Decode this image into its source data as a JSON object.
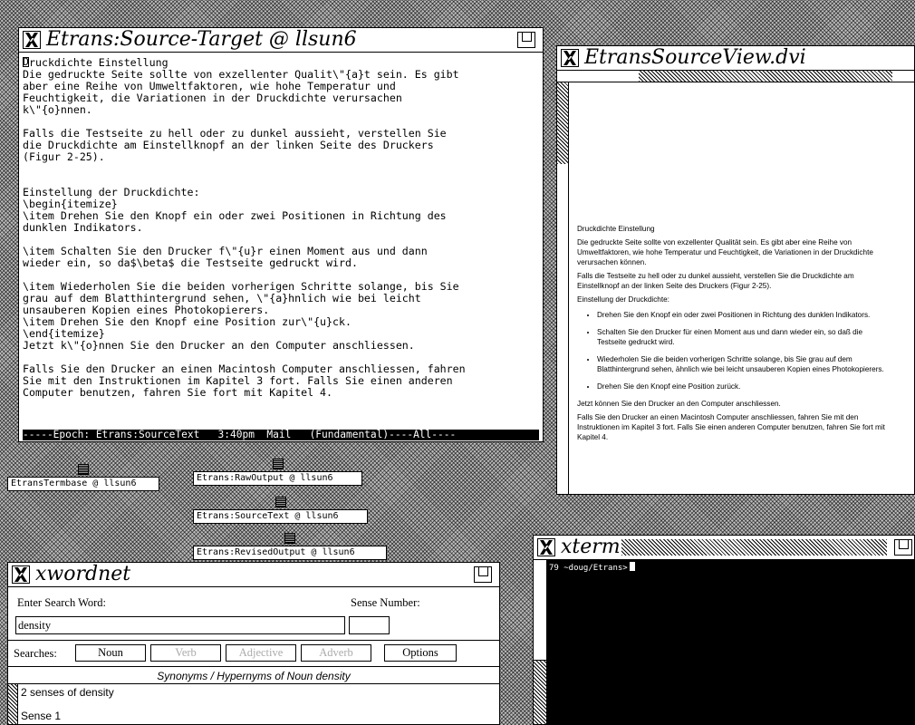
{
  "emacs": {
    "title": "Etrans:Source-Target @ llsun6",
    "first_char": "D",
    "first_line_rest": "ruckdichte Einstellung",
    "body": "\nDie gedruckte Seite sollte von exzellenter Qualit\\\"{a}t sein. Es gibt\naber eine Reihe von Umweltfaktoren, wie hohe Temperatur und\nFeuchtigkeit, die Variationen in der Druckdichte verursachen\nk\\\"{o}nnen.\n\nFalls die Testseite zu hell oder zu dunkel aussieht, verstellen Sie\ndie Druckdichte am Einstellknopf an der linken Seite des Druckers\n(Figur 2-25).\n\n\nEinstellung der Druckdichte:\n\\begin{itemize}\n\\item Drehen Sie den Knopf ein oder zwei Positionen in Richtung des\ndunklen Indikators.\n\n\\item Schalten Sie den Drucker f\\\"{u}r einen Moment aus und dann\nwieder ein, so da$\\beta$ die Testseite gedruckt wird.\n\n\\item Wiederholen Sie die beiden vorherigen Schritte solange, bis Sie\ngrau auf dem Blatthintergrund sehen, \\\"{a}hnlich wie bei leicht\nunsauberen Kopien eines Photokopierers.\n\\item Drehen Sie den Knopf eine Position zur\\\"{u}ck.\n\\end{itemize}\nJetzt k\\\"{o}nnen Sie den Drucker an den Computer anschliessen.\n\nFalls Sie den Drucker an einen Macintosh Computer anschliessen, fahren\nSie mit den Instruktionen im Kapitel 3 fort. Falls Sie einen anderen\nComputer benutzen, fahren Sie fort mit Kapitel 4.",
    "mode_line": "-----Epoch: Etrans:SourceText   3:40pm  Mail   (Fundamental)----All----"
  },
  "dvi": {
    "title": "EtransSourceView.dvi",
    "heading": "Druckdichte Einstellung",
    "para1": "Die gedruckte Seite sollte von exzellenter Qualität sein. Es gibt aber eine Reihe von Umweltfaktoren, wie hohe Temperatur und Feuchtigkeit, die Variationen in der Druckdichte verursachen können.",
    "para2": "Falls die Testseite zu hell oder zu dunkel aussieht, verstellen Sie die Druckdichte am Einstellknopf an der linken Seite des Druckers (Figur 2-25).",
    "para3": "Einstellung der Druckdichte:",
    "items": [
      "Drehen Sie den Knopf ein oder zwei Positionen in Richtung des dunklen Indikators.",
      "Schalten Sie den Drucker für einen Moment aus und dann wieder ein, so daß die Testseite gedruckt wird.",
      "Wiederholen Sie die beiden vorherigen Schritte solange, bis Sie grau auf dem Blatthintergrund sehen, ähnlich wie bei leicht unsauberen Kopien eines Photokopierers.",
      "Drehen Sie den Knopf eine Position zurück."
    ],
    "para4": "Jetzt können Sie den Drucker an den Computer anschliessen.",
    "para5": "Falls Sie den Drucker an einen Macintosh Computer anschliessen, fahren Sie mit den Instruktionen im Kapitel 3 fort. Falls Sie einen anderen Computer benutzen, fahren Sie fort mit Kapitel 4."
  },
  "icons": {
    "termbase": "EtransTermbase @ llsun6",
    "rawoutput": "Etrans:RawOutput @ llsun6",
    "sourcetext": "Etrans:SourceText @ llsun6",
    "revisedoutput": "Etrans:RevisedOutput @ llsun6"
  },
  "xwordnet": {
    "title": "xwordnet",
    "search_label": "Enter Search Word:",
    "search_value": "density",
    "sense_label": "Sense Number:",
    "sense_value": "",
    "searches_label": "Searches:",
    "buttons": {
      "noun": "Noun",
      "verb": "Verb",
      "adjective": "Adjective",
      "adverb": "Adverb",
      "options": "Options"
    },
    "results_heading": "Synonyms / Hypernyms of Noun density",
    "results": [
      "2 senses of density",
      "Sense 1"
    ]
  },
  "xterm": {
    "title": "xterm",
    "prompt": "79 ~doug/Etrans>"
  }
}
